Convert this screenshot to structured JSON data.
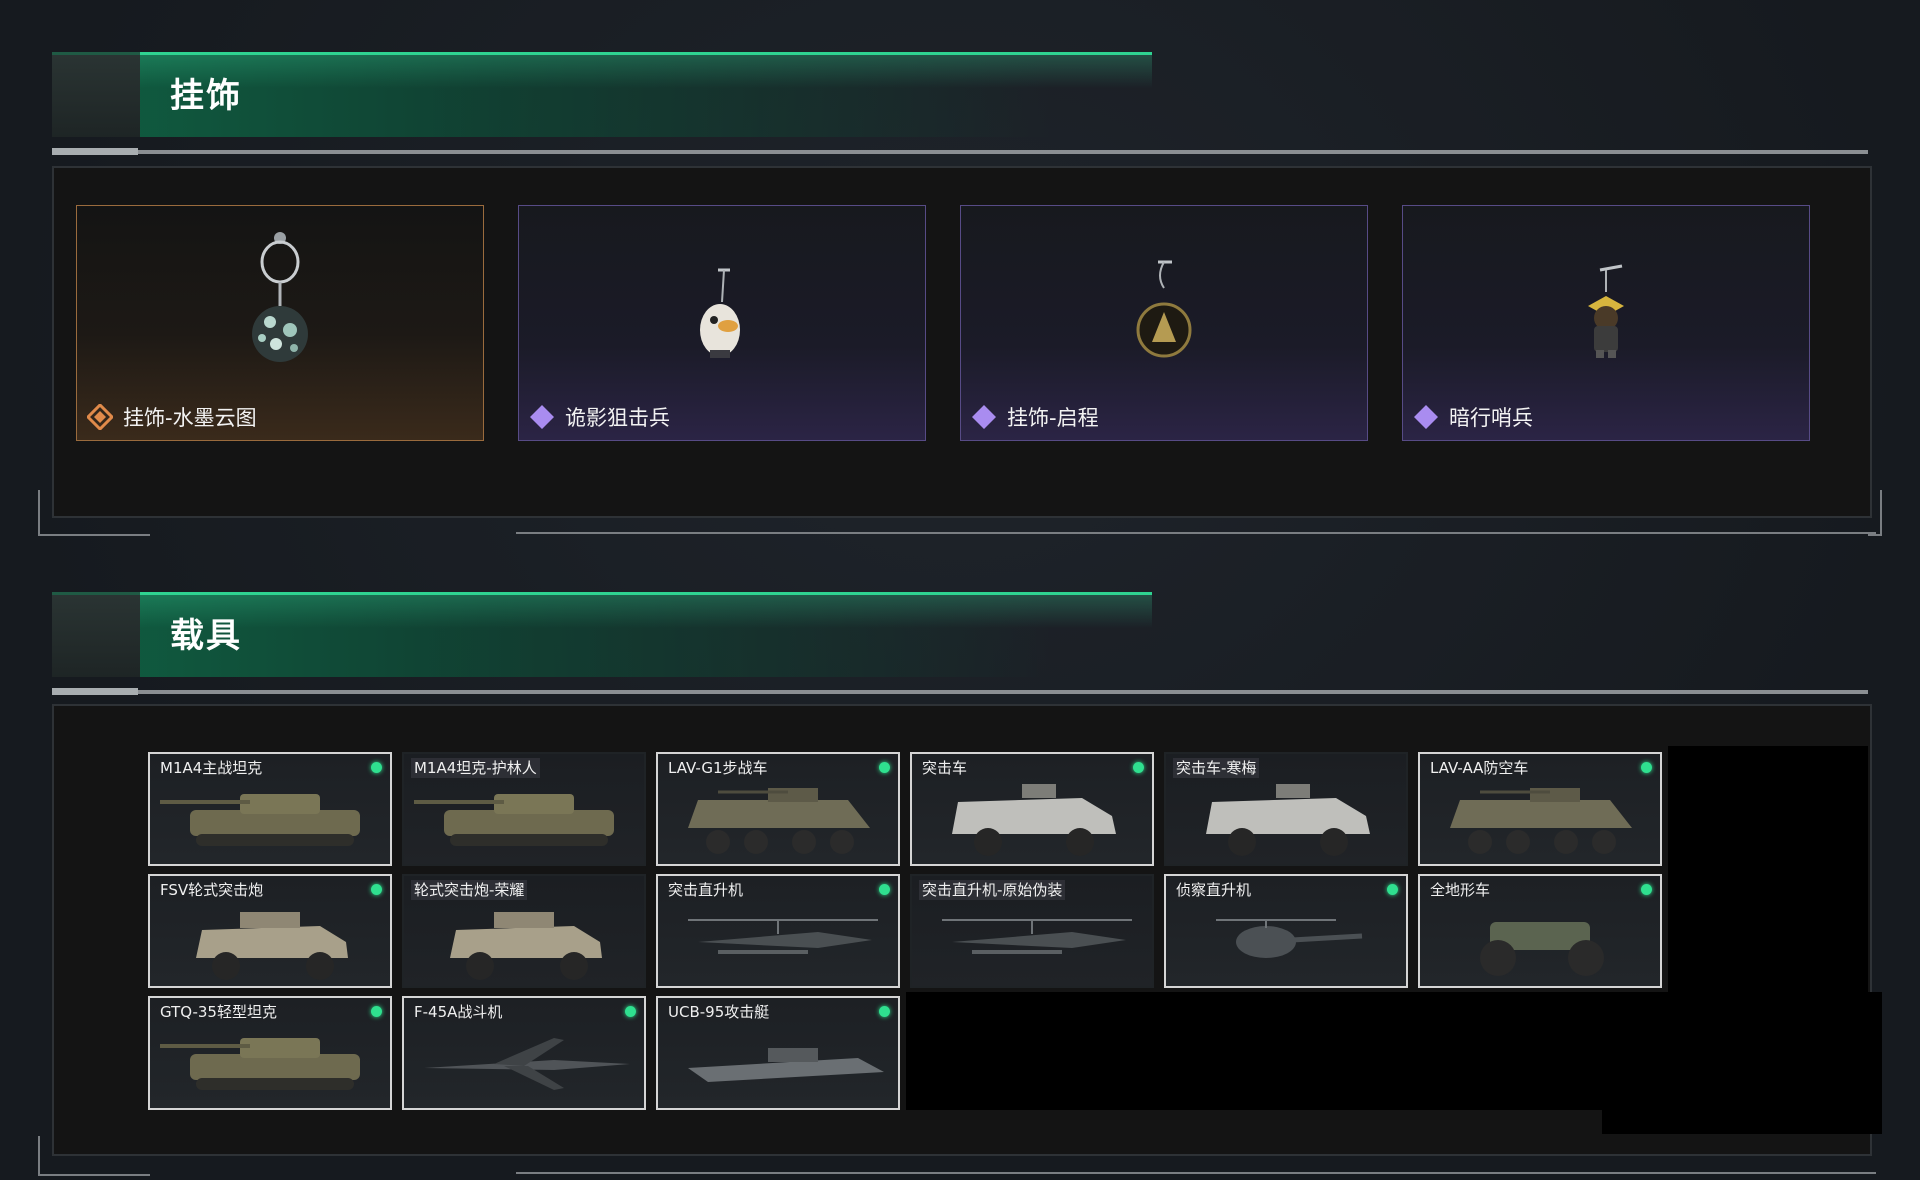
{
  "sections": {
    "charms": {
      "title": "挂饰",
      "items": [
        {
          "name": "挂饰-水墨云图",
          "rarity": "legendary",
          "icon": "charm-orb-icon"
        },
        {
          "name": "诡影狙击兵",
          "rarity": "epic",
          "icon": "charm-bird-icon"
        },
        {
          "name": "挂饰-启程",
          "rarity": "epic",
          "icon": "charm-emblem-icon"
        },
        {
          "name": "暗行哨兵",
          "rarity": "epic",
          "icon": "charm-figure-icon"
        }
      ]
    },
    "vehicles": {
      "title": "载具",
      "items": [
        {
          "name": "M1A4主战坦克",
          "owned": true,
          "icon": "tank-icon"
        },
        {
          "name": "M1A4坦克-护林人",
          "owned": false,
          "icon": "tank-icon"
        },
        {
          "name": "LAV-G1步战车",
          "owned": true,
          "icon": "apc-icon"
        },
        {
          "name": "突击车",
          "owned": true,
          "icon": "armored-truck-icon"
        },
        {
          "name": "突击车-寒梅",
          "owned": false,
          "icon": "armored-truck-icon"
        },
        {
          "name": "LAV-AA防空车",
          "owned": true,
          "icon": "apc-icon"
        },
        {
          "name": "FSV轮式突击炮",
          "owned": true,
          "icon": "armored-car-icon"
        },
        {
          "name": "轮式突击炮-荣耀",
          "owned": false,
          "icon": "armored-car-icon"
        },
        {
          "name": "突击直升机",
          "owned": true,
          "icon": "helicopter-icon"
        },
        {
          "name": "突击直升机-原始伪装",
          "owned": false,
          "icon": "helicopter-icon"
        },
        {
          "name": "侦察直升机",
          "owned": true,
          "icon": "scout-helicopter-icon"
        },
        {
          "name": "全地形车",
          "owned": true,
          "icon": "atv-icon"
        },
        {
          "name": "GTQ-35轻型坦克",
          "owned": true,
          "icon": "tank-icon"
        },
        {
          "name": "F-45A战斗机",
          "owned": true,
          "icon": "jet-icon"
        },
        {
          "name": "UCB-95攻击艇",
          "owned": true,
          "icon": "boat-icon"
        }
      ]
    }
  },
  "colors": {
    "accent": "#2fd391",
    "legendary": "#e08a4a",
    "epic": "#a98cf0",
    "owned_dot": "#2fe08f"
  }
}
